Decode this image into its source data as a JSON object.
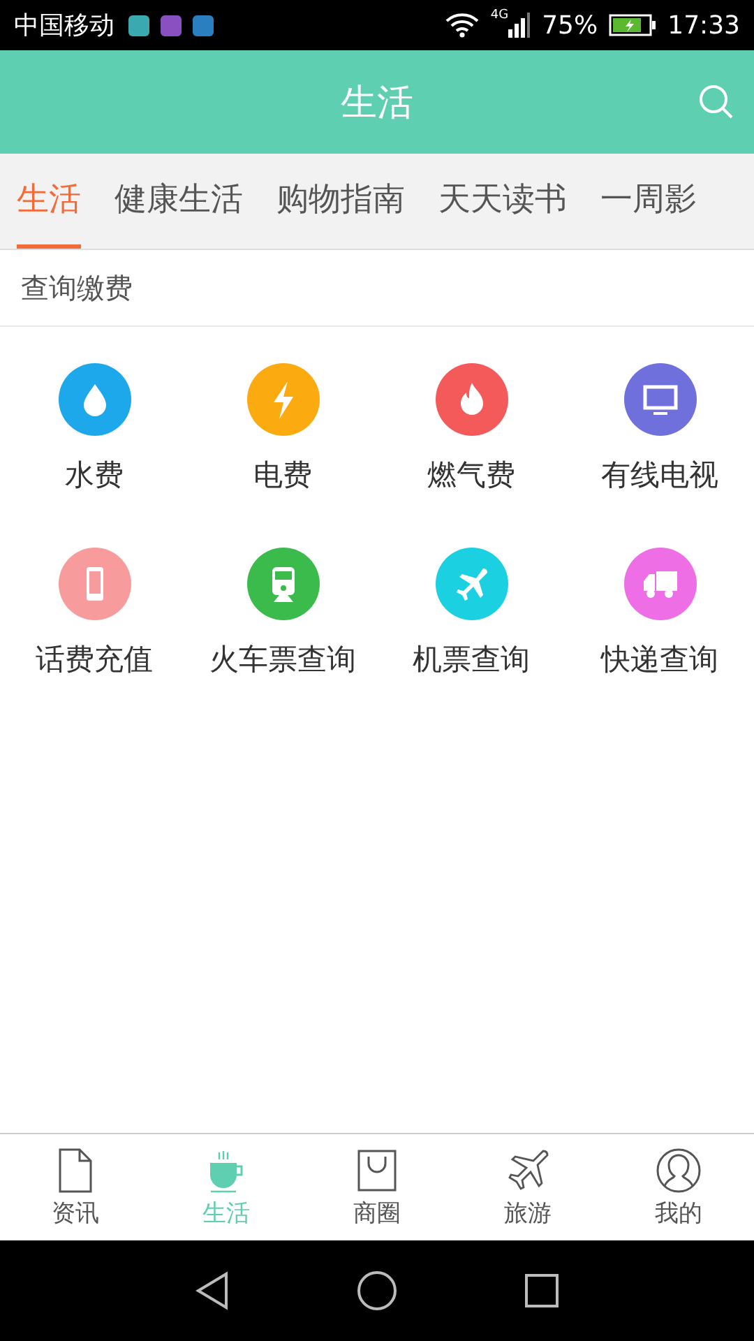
{
  "status_bar": {
    "carrier": "中国移动",
    "network": "4G",
    "battery": "75%",
    "time": "17:33"
  },
  "header": {
    "title": "生活"
  },
  "tabs": [
    {
      "label": "生活",
      "selected": true
    },
    {
      "label": "健康生活",
      "selected": false
    },
    {
      "label": "购物指南",
      "selected": false
    },
    {
      "label": "天天读书",
      "selected": false
    },
    {
      "label": "一周影",
      "selected": false
    }
  ],
  "section": {
    "title": "查询缴费"
  },
  "services": [
    {
      "label": "水费",
      "kind": "water",
      "color": "#1da8ec"
    },
    {
      "label": "电费",
      "kind": "bolt",
      "color": "#fbaa10"
    },
    {
      "label": "燃气费",
      "kind": "fire",
      "color": "#f45a5a"
    },
    {
      "label": "有线电视",
      "kind": "tv",
      "color": "#6f70dc"
    },
    {
      "label": "话费充值",
      "kind": "phone",
      "color": "#f79b9c"
    },
    {
      "label": "火车票查询",
      "kind": "train",
      "color": "#3bbb4c"
    },
    {
      "label": "机票查询",
      "kind": "plane",
      "color": "#1bd0e1"
    },
    {
      "label": "快递查询",
      "kind": "truck",
      "color": "#ee6ee5"
    }
  ],
  "bottom_nav": [
    {
      "label": "资讯",
      "kind": "doc",
      "selected": false
    },
    {
      "label": "生活",
      "kind": "cup",
      "selected": true
    },
    {
      "label": "商圈",
      "kind": "bag",
      "selected": false
    },
    {
      "label": "旅游",
      "kind": "plane",
      "selected": false
    },
    {
      "label": "我的",
      "kind": "person",
      "selected": false
    }
  ]
}
